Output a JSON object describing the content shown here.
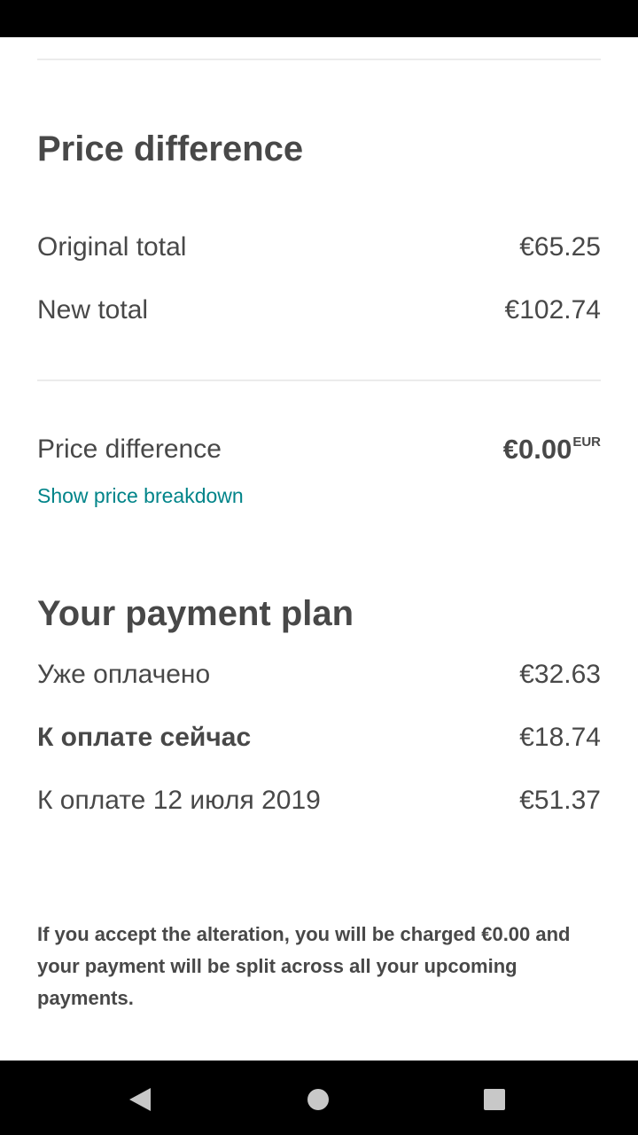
{
  "price_difference_section": {
    "title": "Price difference",
    "rows": [
      {
        "label": "Original total",
        "value": "€65.25"
      },
      {
        "label": "New total",
        "value": "€102.74"
      }
    ],
    "difference": {
      "label": "Price difference",
      "value": "€0.00",
      "currency": "EUR"
    },
    "breakdown_link": "Show price breakdown"
  },
  "payment_plan_section": {
    "title": "Your payment plan",
    "rows": [
      {
        "label": "Уже оплачено",
        "value": "€32.63"
      },
      {
        "label": "К оплате сейчас",
        "value": "€18.74"
      },
      {
        "label": "К оплате 12 июля 2019",
        "value": "€51.37"
      }
    ]
  },
  "note": "If you accept the alteration, you will be charged €0.00 and your payment will be split across all your upcoming payments.",
  "colors": {
    "text": "#484848",
    "link": "#008489",
    "divider": "#ebebeb"
  },
  "nav": {
    "back_icon": "back-triangle-icon",
    "home_icon": "home-circle-icon",
    "recents_icon": "recents-square-icon"
  }
}
